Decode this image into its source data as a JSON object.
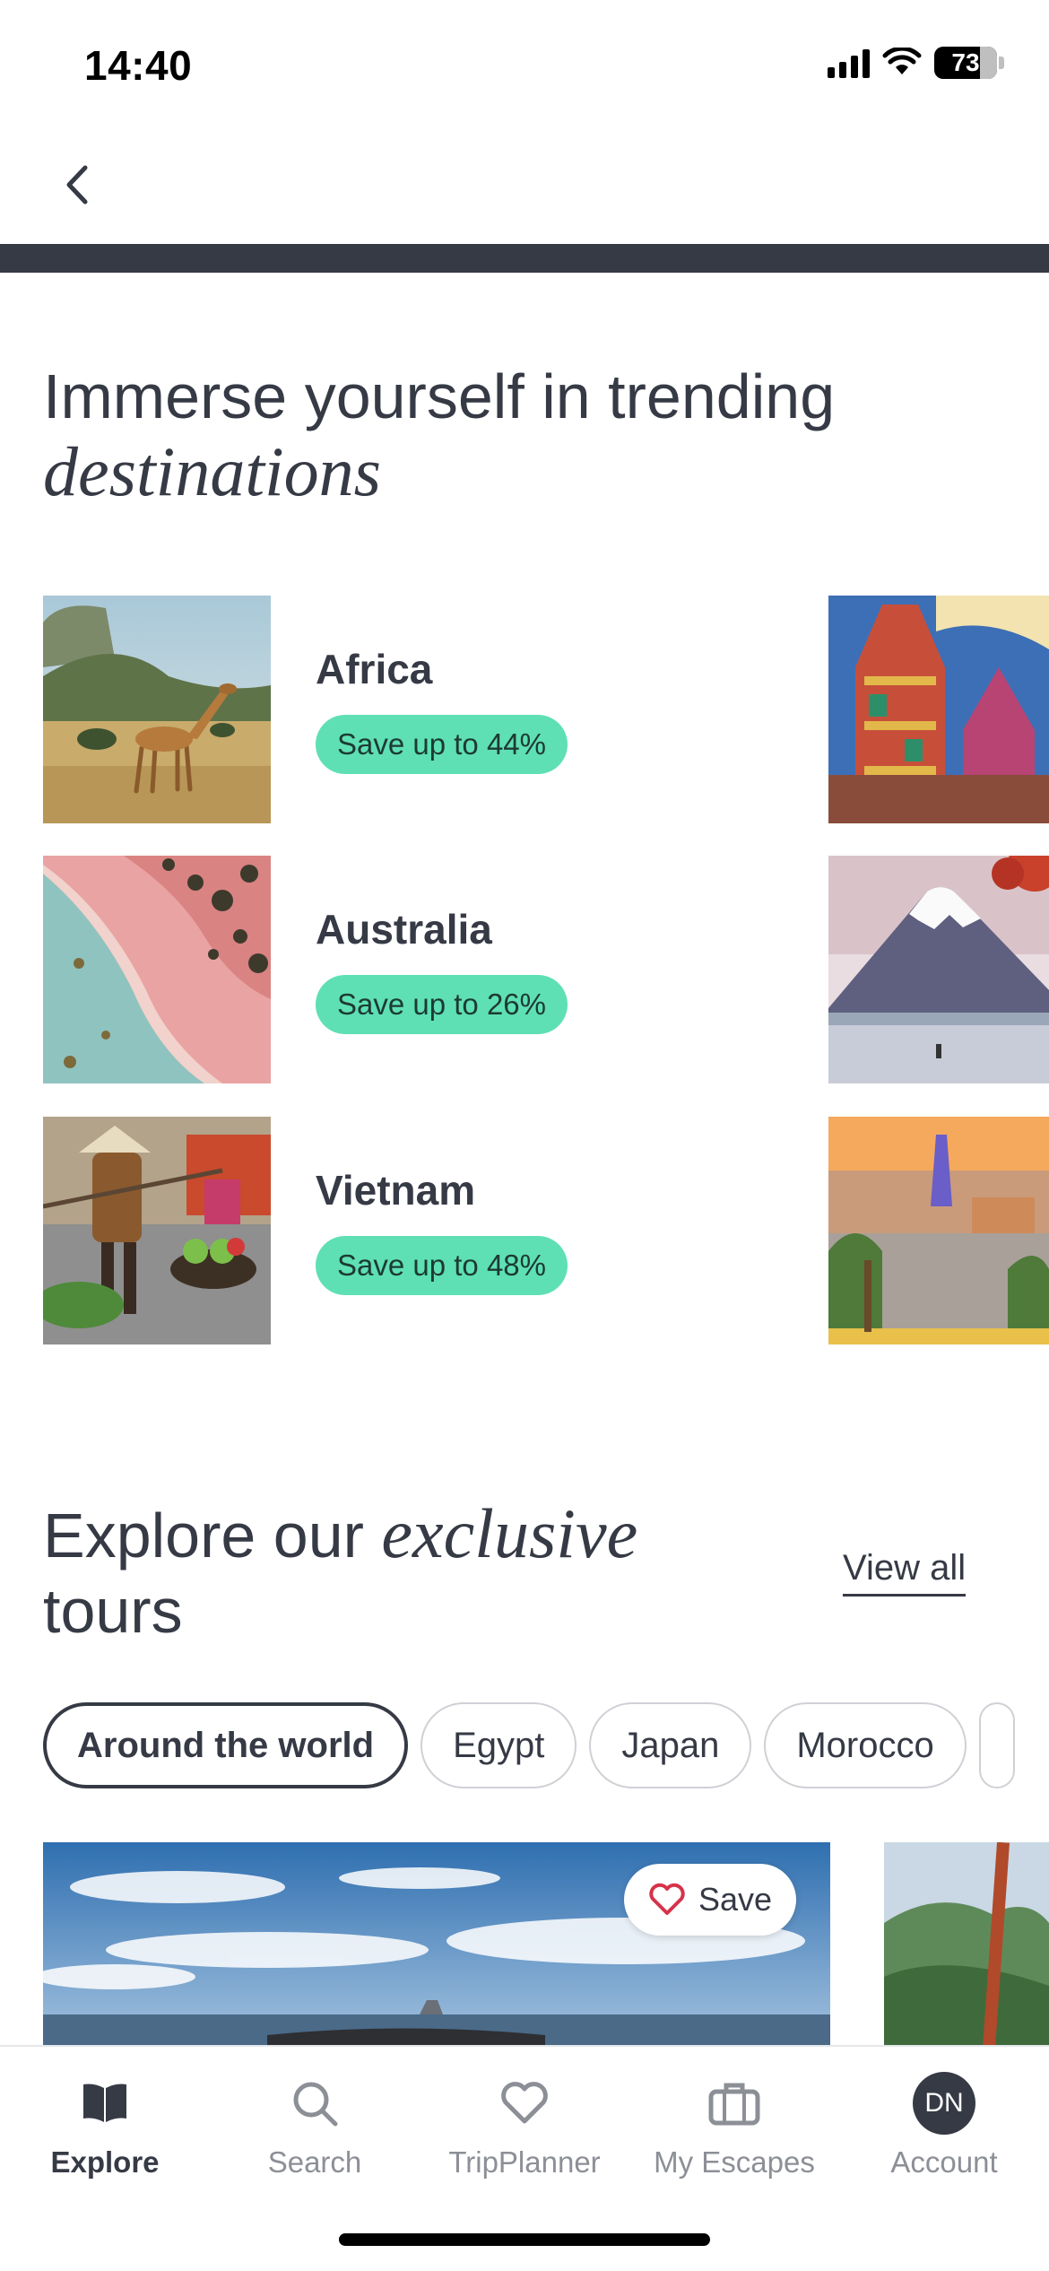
{
  "status_bar": {
    "time": "14:40",
    "battery": "73",
    "battery_fraction": 0.73
  },
  "header": {
    "back_icon": "chevron-left-icon"
  },
  "trending": {
    "title_plain": "Immerse yourself in trending",
    "title_italic": "destinations",
    "destinations": [
      {
        "name": "Africa",
        "badge": "Save up to 44%"
      },
      {
        "name": "Australia",
        "badge": "Save up to 26%"
      },
      {
        "name": "Vietnam",
        "badge": "Save up to 48%"
      }
    ]
  },
  "tours": {
    "title_plain_1": "Explore our",
    "title_italic": "exclusive",
    "title_plain_2": "tours",
    "view_all": "View all",
    "filters": [
      "Around the world",
      "Egypt",
      "Japan",
      "Morocco"
    ],
    "save_label": "Save"
  },
  "nav": {
    "items": [
      {
        "label": "Explore",
        "icon": "book-icon"
      },
      {
        "label": "Search",
        "icon": "search-icon"
      },
      {
        "label": "TripPlanner",
        "icon": "heart-icon"
      },
      {
        "label": "My Escapes",
        "icon": "suitcase-icon"
      },
      {
        "label": "Account",
        "icon": "avatar",
        "initials": "DN"
      }
    ]
  },
  "colors": {
    "text": "#363a45",
    "badge": "#5ee0b4",
    "band": "#363a45",
    "heart": "#d6334a"
  }
}
